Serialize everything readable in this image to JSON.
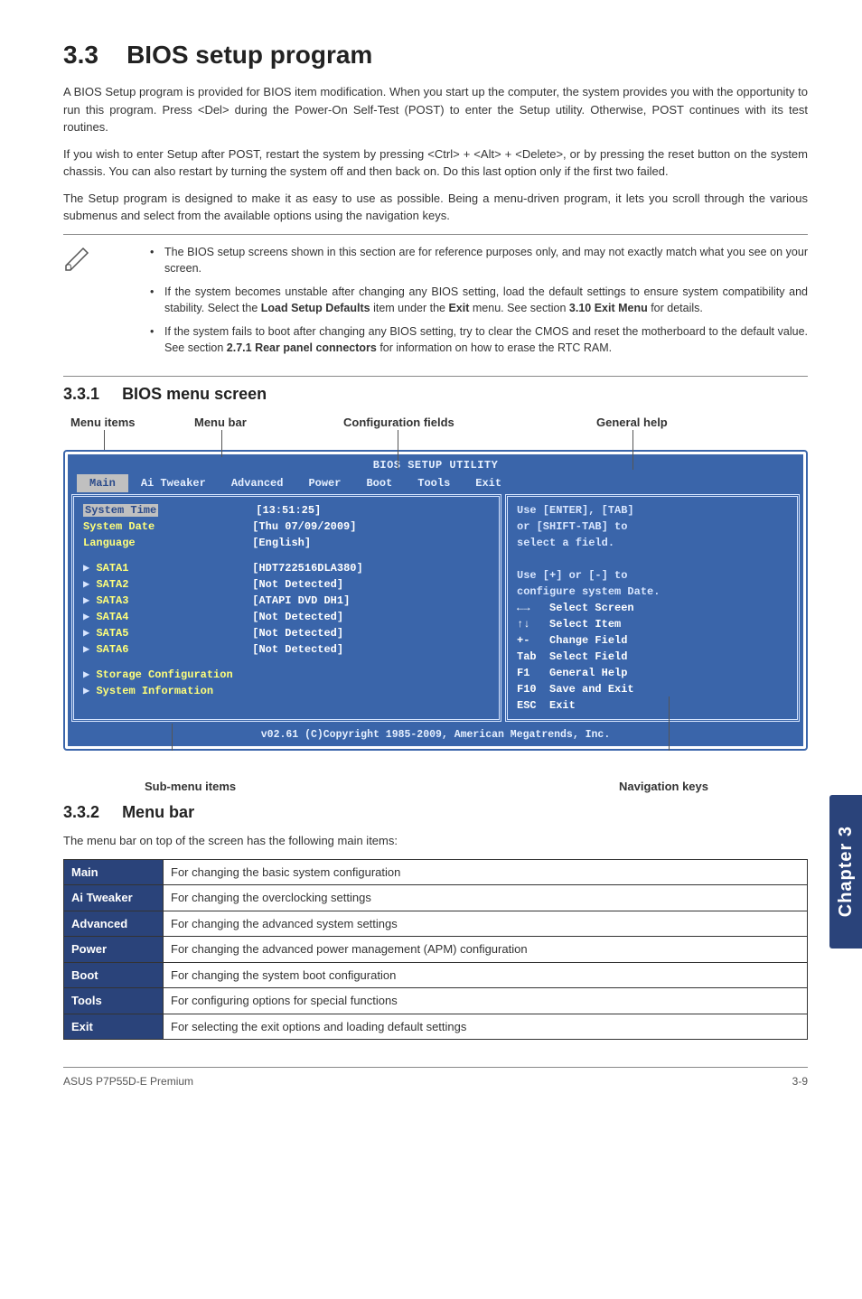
{
  "section": {
    "number": "3.3",
    "title": "BIOS setup program"
  },
  "paragraphs": {
    "p1": "A BIOS Setup program is provided for BIOS item modification. When you start up the computer, the system provides you with the opportunity to run this program. Press <Del> during the Power-On Self-Test (POST) to enter the Setup utility. Otherwise, POST continues with its test routines.",
    "p2": "If you wish to enter Setup after POST, restart the system by pressing <Ctrl> + <Alt> + <Delete>, or by pressing the reset button on the system chassis. You can also restart by turning the system off and then back on. Do this last option only if the first two failed.",
    "p3": "The Setup program is designed to make it as easy to use as possible. Being a menu-driven program, it lets you scroll through the various submenus and select from the available options using the navigation keys."
  },
  "notes": {
    "b1": "The BIOS setup screens shown in this section are for reference purposes only, and may not exactly match what you see on your screen.",
    "b2a": "If the system becomes unstable after changing any BIOS setting, load the default settings to ensure system compatibility and stability. Select the ",
    "b2b": "Load Setup Defaults",
    "b2c": " item under the ",
    "b2d": "Exit",
    "b2e": " menu. See section ",
    "b2f": "3.10 Exit Menu",
    "b2g": " for details.",
    "b3a": "If the system fails to boot after changing any BIOS setting, try to clear the CMOS and reset the motherboard to the default value. See section ",
    "b3b": "2.7.1 Rear panel connectors",
    "b3c": " for information on how to erase the RTC RAM."
  },
  "sub1": {
    "num": "3.3.1",
    "title": "BIOS menu screen"
  },
  "annotations": {
    "menu_items": "Menu items",
    "menu_bar": "Menu bar",
    "config_fields": "Configuration fields",
    "general_help": "General help",
    "sub_menu": "Sub-menu items",
    "nav_keys": "Navigation keys"
  },
  "bios": {
    "title": "BIOS SETUP UTILITY",
    "menubar": [
      "Main",
      "Ai Tweaker",
      "Advanced",
      "Power",
      "Boot",
      "Tools",
      "Exit"
    ],
    "left_top": [
      [
        "System Time",
        "[13:51:25]"
      ],
      [
        "System Date",
        "[Thu 07/09/2009]"
      ],
      [
        "Language",
        "[English]"
      ]
    ],
    "sata": [
      [
        "SATA1",
        "[HDT722516DLA380]"
      ],
      [
        "SATA2",
        "[Not Detected]"
      ],
      [
        "SATA3",
        "[ATAPI DVD DH1]"
      ],
      [
        "SATA4",
        "[Not Detected]"
      ],
      [
        "SATA5",
        "[Not Detected]"
      ],
      [
        "SATA6",
        "[Not Detected]"
      ]
    ],
    "bottom_items": [
      "Storage Configuration",
      "System Information"
    ],
    "help_top": [
      "Use [ENTER], [TAB]",
      "or [SHIFT-TAB] to",
      "select a field.",
      "",
      "Use [+] or [-] to",
      "configure system Date."
    ],
    "help_bottom": [
      "←→   Select Screen",
      "↑↓   Select Item",
      "+-   Change Field",
      "Tab  Select Field",
      "F1   General Help",
      "F10  Save and Exit",
      "ESC  Exit"
    ],
    "footer": "v02.61 (C)Copyright 1985-2009, American Megatrends, Inc."
  },
  "sub2": {
    "num": "3.3.2",
    "title": "Menu bar"
  },
  "menubar_intro": "The menu bar on top of the screen has the following main items:",
  "menubar_table": [
    [
      "Main",
      "For changing the basic system configuration"
    ],
    [
      "Ai Tweaker",
      "For changing the overclocking settings"
    ],
    [
      "Advanced",
      "For changing the advanced system settings"
    ],
    [
      "Power",
      "For changing the advanced power management (APM) configuration"
    ],
    [
      "Boot",
      "For changing the system boot configuration"
    ],
    [
      "Tools",
      "For configuring options for special functions"
    ],
    [
      "Exit",
      "For selecting the exit options and loading default settings"
    ]
  ],
  "sidetab": "Chapter 3",
  "footer": {
    "left": "ASUS P7P55D-E Premium",
    "right": "3-9"
  }
}
